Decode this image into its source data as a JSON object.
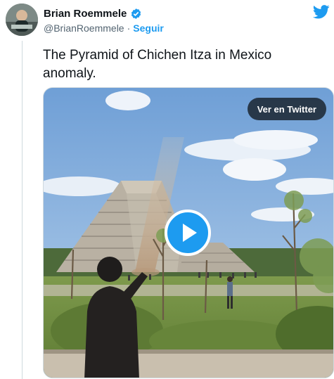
{
  "author": {
    "display_name": "Brian Roemmele",
    "handle": "@BrianRoemmele",
    "separator": "·",
    "follow_label": "Seguir"
  },
  "tweet": {
    "text": "The Pyramid of Chichen Itza in Mexico anomaly."
  },
  "media": {
    "watch_label": "Ver en Twitter"
  },
  "icons": {
    "brand": "twitter-bird-icon",
    "verified": "verified-badge-icon",
    "play": "play-icon"
  },
  "colors": {
    "accent": "#1d9bf0",
    "text": "#0f1419",
    "secondary_text": "#536471"
  }
}
